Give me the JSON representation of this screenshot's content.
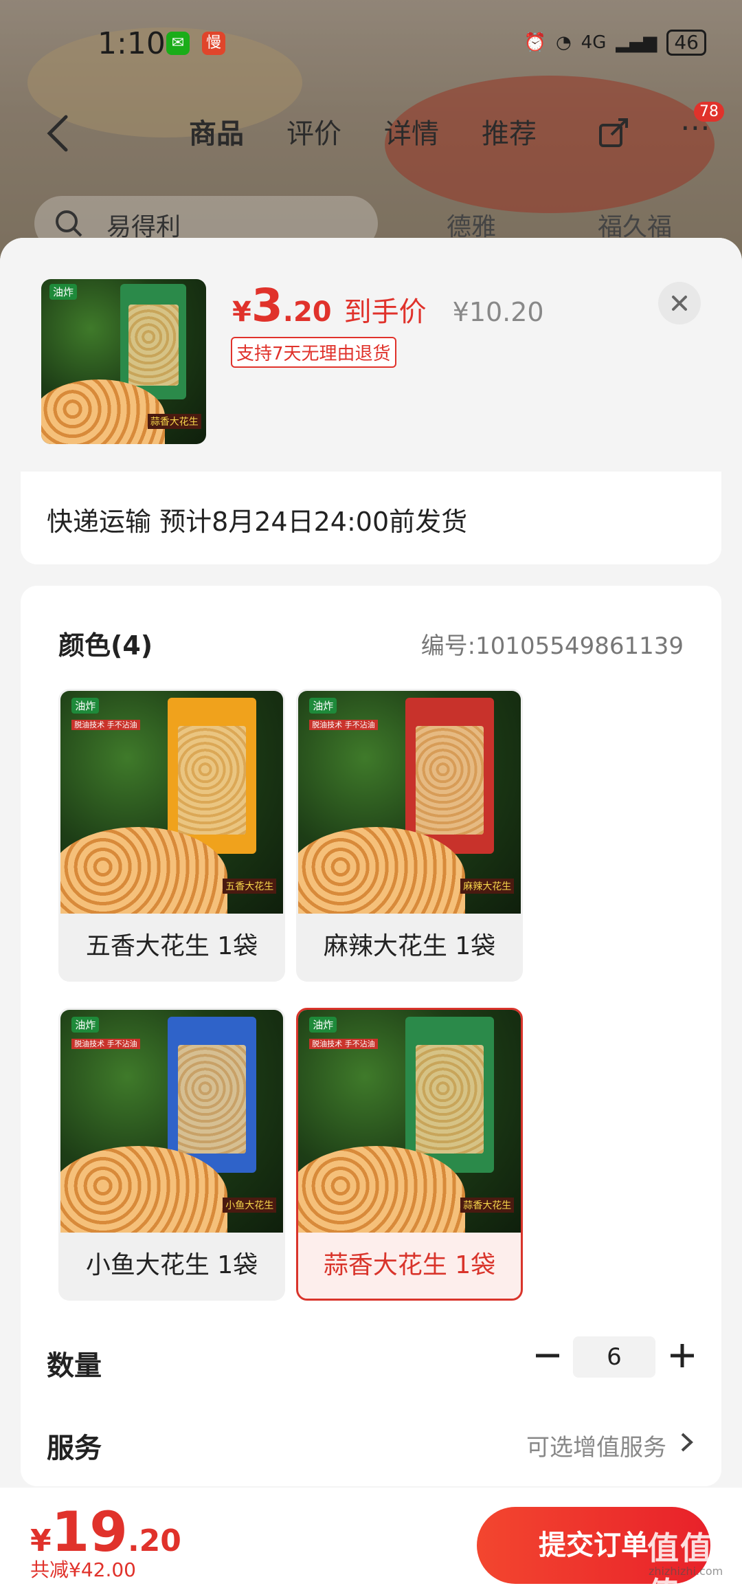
{
  "status": {
    "time": "1:10",
    "network": "4G",
    "battery": "46",
    "app_badge_slow": "慢"
  },
  "nav": {
    "tabs": [
      "商品",
      "评价",
      "详情",
      "推荐"
    ],
    "active_tab": "商品",
    "more_badge": "78"
  },
  "search": {
    "text": "易得利",
    "brand_1": "德雅",
    "brand_2": "福久福"
  },
  "sheet": {
    "price_yen": "¥",
    "price_int": "3",
    "price_dec": ".20",
    "price_tag": "到手价",
    "original_price": "¥10.20",
    "return_badge": "支持7天无理由退货",
    "delivery": "快递运输 预计8月24日24:00前发货",
    "color_title": "颜色(4)",
    "sku_code": "编号:10105549861139",
    "options": [
      {
        "label": "五香大花生 1袋",
        "pack_color": "#f0a21c",
        "selected": false
      },
      {
        "label": "麻辣大花生 1袋",
        "pack_color": "#c8322b",
        "selected": false
      },
      {
        "label": "小鱼大花生 1袋",
        "pack_color": "#2f63c9",
        "selected": false
      },
      {
        "label": "蒜香大花生 1袋",
        "pack_color": "#2b8a4a",
        "selected": true
      }
    ],
    "art_tag": "油炸",
    "art_tag2": "脱油技术 手不沾油",
    "art_labels": [
      "五香大花生",
      "麻辣大花生",
      "小鱼大花生",
      "蒜香大花生"
    ],
    "quantity_label": "数量",
    "quantity": "6",
    "service_label": "服务",
    "service_value": "可选增值服务"
  },
  "bottom": {
    "total_yen": "¥",
    "total_int": "19",
    "total_dec": ".20",
    "saving": "共减¥42.00",
    "submit": "提交订单",
    "watermark": "值值值",
    "watermark_sub": "zhizhizhi.com"
  },
  "colors": {
    "accent": "#e0322b",
    "sheet_bg": "#f4f4f4"
  }
}
